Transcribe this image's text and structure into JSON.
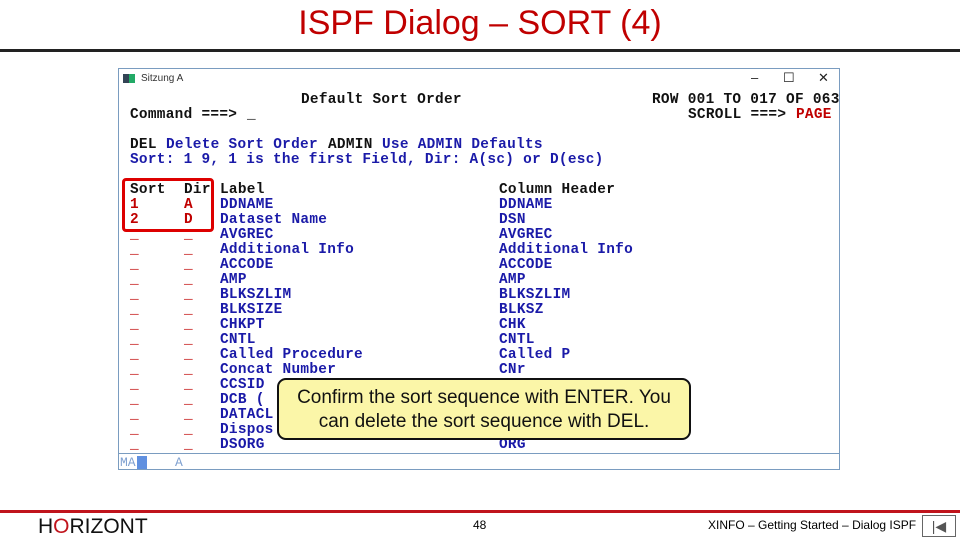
{
  "slide": {
    "title": "ISPF Dialog – SORT (4)",
    "page": "48",
    "footer": "XINFO – Getting Started – Dialog ISPF",
    "logo": "HORIZONT",
    "logo_parts": [
      "H",
      "O",
      "RIZONT"
    ]
  },
  "window": {
    "title": "Sitzung A",
    "minimize": "–",
    "maximize": "☐",
    "close": "✕"
  },
  "screen": {
    "panel_title": "Default Sort Order",
    "command_label": "Command ===>",
    "command_value": "_",
    "row_info": "ROW 001 TO 017 OF 063",
    "scroll_label": "SCROLL ===>",
    "scroll_value": "PAGE",
    "cmd1_key": "DEL",
    "cmd1_desc": "Delete Sort Order",
    "cmd2_key": "ADMIN",
    "cmd2_desc": "Use ADMIN Defaults",
    "hint": "Sort: 1 9, 1 is the first Field, Dir: A(sc) or D(esc)",
    "headers": {
      "sort": "Sort",
      "dir": "Dir",
      "label": "Label",
      "column": "Column Header"
    },
    "rows": [
      {
        "sort": "1",
        "dir": "A",
        "label": "DDNAME",
        "column": "DDNAME"
      },
      {
        "sort": "2",
        "dir": "D",
        "label": "Dataset Name",
        "column": "DSN"
      },
      {
        "sort": "_",
        "dir": "_",
        "label": "AVGREC",
        "column": "AVGREC"
      },
      {
        "sort": "_",
        "dir": "_",
        "label": "Additional Info",
        "column": "Additional Info"
      },
      {
        "sort": "_",
        "dir": "_",
        "label": "ACCODE",
        "column": "ACCODE"
      },
      {
        "sort": "_",
        "dir": "_",
        "label": "AMP",
        "column": "AMP"
      },
      {
        "sort": "_",
        "dir": "_",
        "label": "BLKSZLIM",
        "column": "BLKSZLIM"
      },
      {
        "sort": "_",
        "dir": "_",
        "label": "BLKSIZE",
        "column": "BLKSZ"
      },
      {
        "sort": "_",
        "dir": "_",
        "label": "CHKPT",
        "column": "CHK"
      },
      {
        "sort": "_",
        "dir": "_",
        "label": "CNTL",
        "column": "CNTL"
      },
      {
        "sort": "_",
        "dir": "_",
        "label": "Called Procedure",
        "column": "Called P"
      },
      {
        "sort": "_",
        "dir": "_",
        "label": "Concat Number",
        "column": "CNr"
      },
      {
        "sort": "_",
        "dir": "_",
        "label": "CCSID",
        "column": ""
      },
      {
        "sort": "_",
        "dir": "_",
        "label": "DCB (",
        "column": ""
      },
      {
        "sort": "_",
        "dir": "_",
        "label": "DATACL",
        "column": ""
      },
      {
        "sort": "_",
        "dir": "_",
        "label": "Dispos",
        "column": ""
      },
      {
        "sort": "_",
        "dir": "_",
        "label": "DSORG",
        "column": "ORG"
      }
    ],
    "status_left": "MA",
    "status_mid": "A"
  },
  "callout": {
    "line1": "Confirm the sort sequence with ENTER. You",
    "line2": "can delete the sort sequence with DEL."
  },
  "colors": {
    "title": "#c00000",
    "terminal_text": "#1a1aa8",
    "callout_bg": "#fbf6a8",
    "highlight": "#d00000"
  }
}
